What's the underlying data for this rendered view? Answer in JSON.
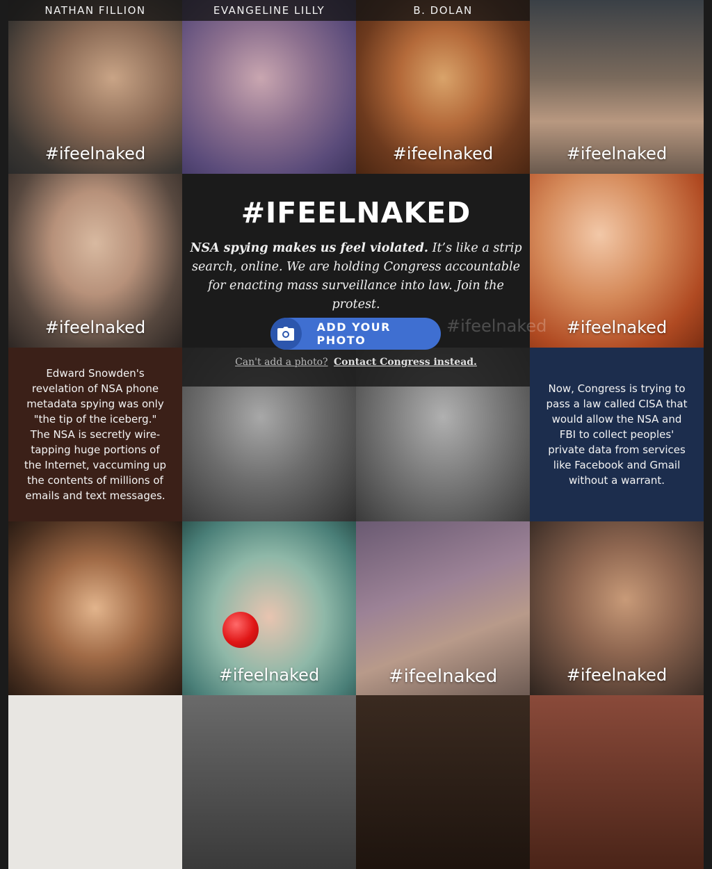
{
  "tiles": {
    "t1": {
      "name": "NATHAN FILLION",
      "tag": "#ifeelnaked"
    },
    "t2": {
      "name": "EVANGELINE LILLY"
    },
    "t3": {
      "name": "B. DOLAN",
      "tag": "#ifeelnaked"
    },
    "t4": {
      "tag": "#ifeelnaked"
    },
    "t5": {
      "tag": "#ifeelnaked"
    },
    "t6": {
      "tag": "#ifeelnaked"
    },
    "t7": {
      "tag": "#ifeelnaked"
    },
    "t8": {
      "tag": "#ifeelnaked"
    },
    "t9": {
      "tag": "#ifeelnaked"
    },
    "t10": {
      "tag": "#ifeelnaked"
    }
  },
  "info_left": {
    "text": "Edward Snowden's revelation of NSA phone metadata spying was only \"the tip of the iceberg.\" The NSA is secretly wire-tapping huge portions of the Internet, vaccuming up the contents of millions of emails and text messages.",
    "bg_color": "#3b2018"
  },
  "info_right": {
    "text": "Now, Congress is trying to pass a law called CISA that would allow the NSA and FBI to collect peoples' private data from services like Facebook and Gmail without a warrant.",
    "bg_color": "#1c2d4d"
  },
  "hero": {
    "title": "#IFEELNAKED",
    "lede_bold": "NSA spying makes us feel violated.",
    "lede_rest": " It’s like a strip search, online. We are holding Congress accountable for enacting mass surveillance into law. Join the protest.",
    "button_label": "ADD YOUR PHOTO",
    "button_icon": "camera-icon",
    "button_color": "#3f6fd1",
    "contact_prefix": "Can't add a photo?",
    "contact_link": "Contact Congress instead."
  }
}
